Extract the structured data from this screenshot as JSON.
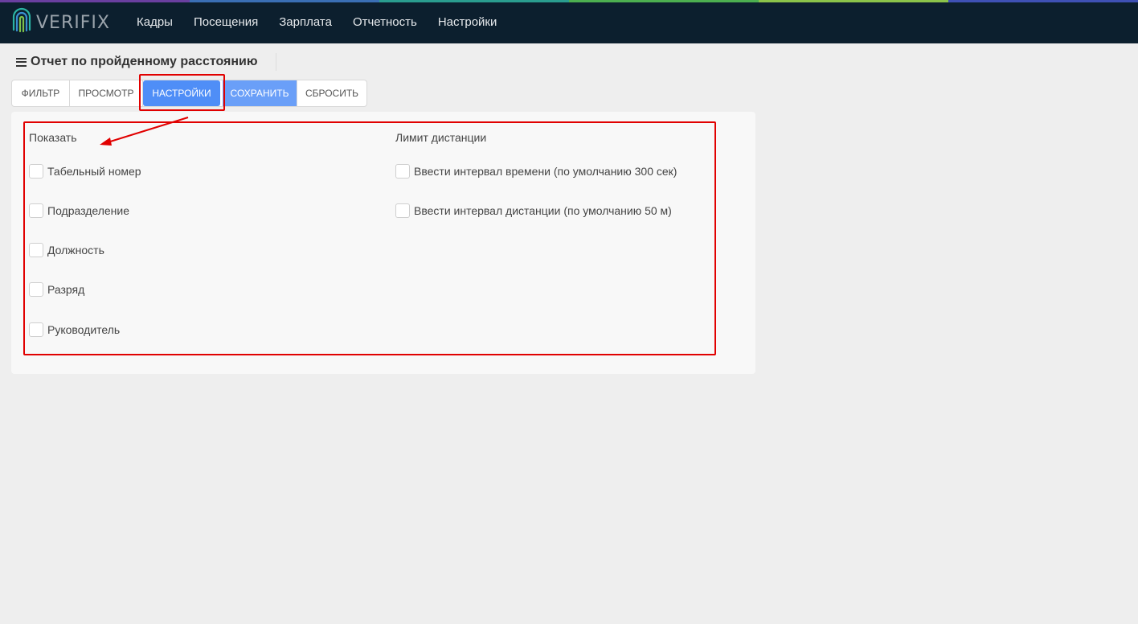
{
  "brand": {
    "name": "VERIFIX",
    "logo_icon": "fingerprint-icon",
    "stripe_colors": [
      "#6a3fa0",
      "#3a6fb5",
      "#2a9d8f",
      "#4caf50",
      "#8bc34a",
      "#3f51b5"
    ]
  },
  "nav": {
    "items": [
      {
        "label": "Кадры"
      },
      {
        "label": "Посещения"
      },
      {
        "label": "Зарплата"
      },
      {
        "label": "Отчетность"
      },
      {
        "label": "Настройки"
      }
    ]
  },
  "page": {
    "menu_icon": "hamburger-icon",
    "title": "Отчет по пройденному расстоянию"
  },
  "toolbar": {
    "filter_label": "Фильтр",
    "view_label": "Просмотр",
    "settings_label": "Настройки",
    "save_label": "Сохранить",
    "reset_label": "Сбросить",
    "active": "settings",
    "accent_color": "#4f8ef7"
  },
  "settings": {
    "show": {
      "title": "Показать",
      "options": [
        {
          "label": "Табельный номер",
          "checked": false
        },
        {
          "label": "Подразделение",
          "checked": false
        },
        {
          "label": "Должность",
          "checked": false
        },
        {
          "label": "Разряд",
          "checked": false
        },
        {
          "label": "Руководитель",
          "checked": false
        }
      ]
    },
    "distance_limit": {
      "title": "Лимит дистанции",
      "options": [
        {
          "label": "Ввести интервал времени (по умолчанию 300 сек)",
          "checked": false
        },
        {
          "label": "Ввести интервал дистанции (по умолчанию 50 м)",
          "checked": false
        }
      ]
    }
  },
  "annotation": {
    "color": "#e10000"
  }
}
